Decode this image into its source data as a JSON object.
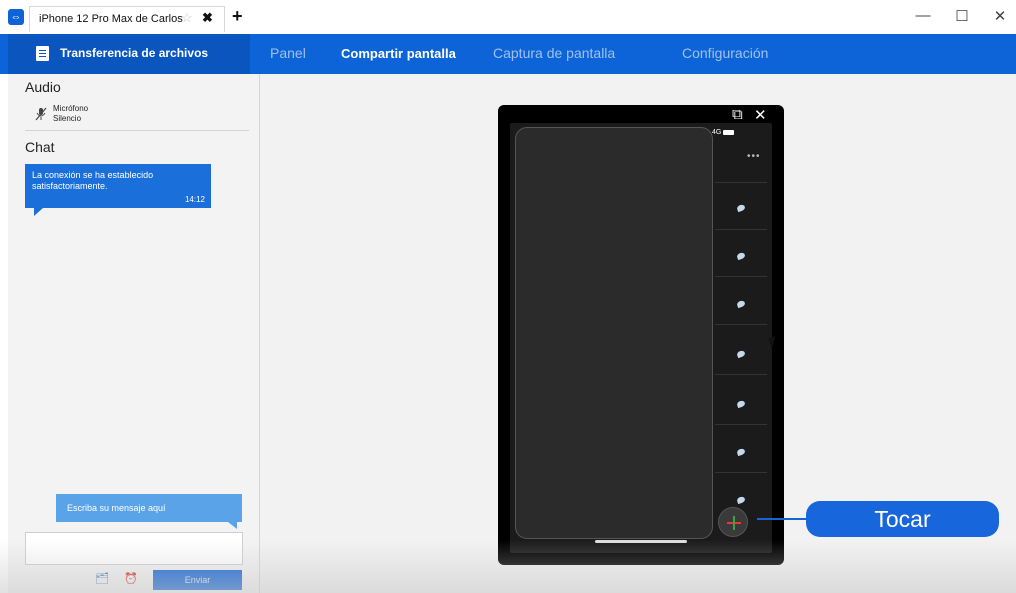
{
  "window": {
    "tab_title": "iPhone 12 Pro Max de Carlos",
    "tab_star": "☆",
    "tab_close": "✖",
    "new_tab": "+",
    "minimize": "—",
    "maximize": "☐",
    "close": "✕"
  },
  "nav": {
    "file_transfer": "Transferencia de archivos",
    "tabs": [
      {
        "label": "Panel",
        "active": false
      },
      {
        "label": "Compartir pantalla",
        "active": true
      },
      {
        "label": "Captura de pantalla",
        "active": false
      },
      {
        "label": "Configuración",
        "active": false
      }
    ]
  },
  "sidebar": {
    "audio_title": "Audio",
    "mic_label": "Micrófono",
    "mic_status": "Silencio",
    "chat_title": "Chat",
    "message": {
      "text": "La conexión se ha establecido satisfactoriamente.",
      "time": "14:12"
    },
    "input_placeholder": "Escriba su mensaje aquí",
    "send_label": "Enviar"
  },
  "phone": {
    "open_external": "⧉",
    "close": "✕",
    "status": "4G",
    "more": "•••"
  },
  "callout": {
    "label": "Tocar"
  },
  "colors": {
    "accent": "#0d64d8",
    "nav_dark": "#0a56be",
    "bubble": "#1b6fda",
    "hint": "#5aa3e8"
  }
}
